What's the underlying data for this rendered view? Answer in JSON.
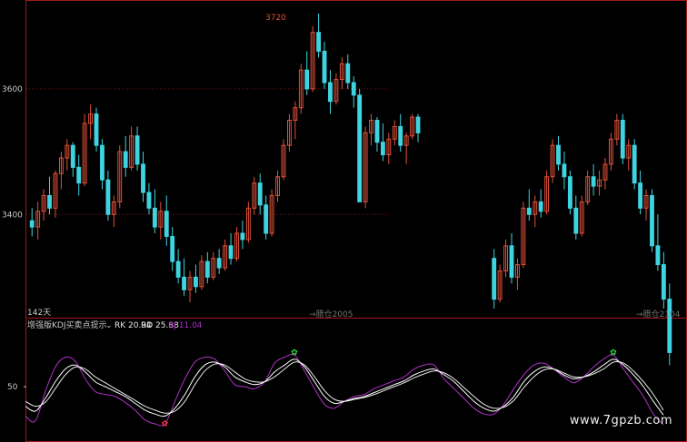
{
  "chart_data": [
    {
      "type": "candlestick",
      "ylim": [
        3250,
        3730
      ],
      "y_ticks": [
        3400,
        3600
      ],
      "annotations": {
        "peak_label": "3720",
        "bar_count": "142天",
        "date_mid": "→腊仓2005",
        "date_right": "→腊仓2104"
      },
      "colors": {
        "up": "#e0503a",
        "down": "#3fd3e0",
        "grid": "#7a1515",
        "frame": "#a01818",
        "text": "#c8c8c8"
      },
      "series": [
        {
          "name": "index",
          "ohlc": [
            [
              3390,
              3410,
              3365,
              3380
            ],
            [
              3380,
              3420,
              3360,
              3405
            ],
            [
              3405,
              3440,
              3390,
              3430
            ],
            [
              3430,
              3460,
              3400,
              3410
            ],
            [
              3410,
              3470,
              3395,
              3465
            ],
            [
              3465,
              3500,
              3440,
              3490
            ],
            [
              3490,
              3520,
              3470,
              3510
            ],
            [
              3510,
              3515,
              3460,
              3475
            ],
            [
              3475,
              3495,
              3430,
              3450
            ],
            [
              3450,
              3560,
              3445,
              3545
            ],
            [
              3545,
              3575,
              3520,
              3560
            ],
            [
              3560,
              3570,
              3500,
              3510
            ],
            [
              3510,
              3520,
              3440,
              3455
            ],
            [
              3455,
              3470,
              3390,
              3400
            ],
            [
              3400,
              3430,
              3380,
              3420
            ],
            [
              3420,
              3510,
              3410,
              3500
            ],
            [
              3500,
              3525,
              3460,
              3475
            ],
            [
              3475,
              3540,
              3470,
              3525
            ],
            [
              3525,
              3540,
              3470,
              3480
            ],
            [
              3480,
              3500,
              3420,
              3435
            ],
            [
              3435,
              3450,
              3400,
              3410
            ],
            [
              3410,
              3440,
              3370,
              3380
            ],
            [
              3380,
              3420,
              3360,
              3405
            ],
            [
              3405,
              3430,
              3350,
              3365
            ],
            [
              3365,
              3380,
              3310,
              3325
            ],
            [
              3325,
              3345,
              3290,
              3300
            ],
            [
              3300,
              3330,
              3270,
              3280
            ],
            [
              3280,
              3310,
              3260,
              3300
            ],
            [
              3300,
              3320,
              3275,
              3285
            ],
            [
              3285,
              3335,
              3280,
              3325
            ],
            [
              3325,
              3340,
              3290,
              3300
            ],
            [
              3300,
              3340,
              3295,
              3330
            ],
            [
              3330,
              3345,
              3305,
              3315
            ],
            [
              3315,
              3360,
              3310,
              3350
            ],
            [
              3350,
              3370,
              3320,
              3330
            ],
            [
              3330,
              3380,
              3325,
              3370
            ],
            [
              3370,
              3390,
              3345,
              3360
            ],
            [
              3360,
              3420,
              3355,
              3410
            ],
            [
              3410,
              3460,
              3400,
              3450
            ],
            [
              3450,
              3465,
              3400,
              3415
            ],
            [
              3415,
              3430,
              3360,
              3370
            ],
            [
              3370,
              3440,
              3365,
              3430
            ],
            [
              3430,
              3470,
              3420,
              3460
            ],
            [
              3460,
              3520,
              3455,
              3510
            ],
            [
              3510,
              3560,
              3500,
              3550
            ],
            [
              3550,
              3580,
              3520,
              3570
            ],
            [
              3570,
              3640,
              3560,
              3630
            ],
            [
              3630,
              3660,
              3590,
              3600
            ],
            [
              3600,
              3700,
              3595,
              3690
            ],
            [
              3690,
              3720,
              3650,
              3660
            ],
            [
              3660,
              3675,
              3600,
              3610
            ],
            [
              3610,
              3630,
              3560,
              3580
            ],
            [
              3580,
              3625,
              3575,
              3615
            ],
            [
              3615,
              3650,
              3600,
              3640
            ],
            [
              3640,
              3655,
              3600,
              3610
            ],
            [
              3610,
              3620,
              3570,
              3590
            ],
            [
              3590,
              3600,
              3520,
              3420
            ],
            [
              3420,
              3540,
              3410,
              3530
            ],
            [
              3530,
              3560,
              3510,
              3550
            ],
            [
              3550,
              3555,
              3500,
              3515
            ],
            [
              3515,
              3545,
              3485,
              3495
            ],
            [
              3495,
              3530,
              3480,
              3520
            ],
            [
              3520,
              3550,
              3510,
              3540
            ],
            [
              3540,
              3560,
              3500,
              3510
            ],
            [
              3510,
              3530,
              3480,
              3525
            ],
            [
              3525,
              3560,
              3520,
              3555
            ],
            [
              3555,
              3560,
              3515,
              3530
            ],
            null,
            null,
            null,
            null,
            null,
            null,
            null,
            null,
            null,
            null,
            null,
            null,
            [
              3330,
              3345,
              3250,
              3265
            ],
            [
              3265,
              3320,
              3260,
              3310
            ],
            [
              3310,
              3360,
              3300,
              3350
            ],
            [
              3350,
              3370,
              3290,
              3300
            ],
            [
              3300,
              3330,
              3280,
              3320
            ],
            [
              3320,
              3420,
              3315,
              3410
            ],
            [
              3410,
              3440,
              3390,
              3400
            ],
            [
              3400,
              3430,
              3380,
              3420
            ],
            [
              3420,
              3440,
              3395,
              3405
            ],
            [
              3405,
              3470,
              3400,
              3460
            ],
            [
              3460,
              3520,
              3450,
              3510
            ],
            [
              3510,
              3525,
              3470,
              3480
            ],
            [
              3480,
              3500,
              3440,
              3460
            ],
            [
              3460,
              3470,
              3400,
              3410
            ],
            [
              3410,
              3430,
              3360,
              3370
            ],
            [
              3370,
              3430,
              3365,
              3420
            ],
            [
              3420,
              3470,
              3415,
              3460
            ],
            [
              3460,
              3480,
              3430,
              3445
            ],
            [
              3445,
              3470,
              3430,
              3455
            ],
            [
              3455,
              3490,
              3440,
              3480
            ],
            [
              3480,
              3530,
              3470,
              3520
            ],
            [
              3520,
              3560,
              3510,
              3550
            ],
            [
              3550,
              3560,
              3480,
              3490
            ],
            [
              3490,
              3520,
              3470,
              3510
            ],
            [
              3510,
              3520,
              3440,
              3450
            ],
            [
              3450,
              3470,
              3400,
              3410
            ],
            [
              3410,
              3440,
              3390,
              3430
            ],
            [
              3430,
              3440,
              3340,
              3350
            ],
            [
              3350,
              3400,
              3310,
              3320
            ],
            [
              3320,
              3340,
              3250,
              3265
            ],
            [
              3265,
              3290,
              3160,
              3180
            ]
          ]
        }
      ]
    },
    {
      "type": "line",
      "title": "增强版KDJ买卖点提示",
      "ylim": [
        0,
        100
      ],
      "y_ticks": [
        50
      ],
      "series": [
        {
          "name": "RK",
          "label": "RK 20.94",
          "color": "#ffffff",
          "values": [
            30,
            25,
            38,
            55,
            68,
            72,
            65,
            55,
            50,
            45,
            40,
            33,
            26,
            22,
            20,
            28,
            42,
            60,
            72,
            75,
            70,
            60,
            55,
            52,
            55,
            65,
            72,
            78,
            70,
            55,
            40,
            33,
            35,
            38,
            40,
            44,
            48,
            52,
            56,
            62,
            66,
            68,
            62,
            55,
            45,
            35,
            28,
            25,
            30,
            40,
            55,
            65,
            70,
            68,
            62,
            58,
            60,
            65,
            72,
            78,
            72,
            62,
            50,
            35,
            21
          ]
        },
        {
          "name": "RD",
          "label": "RD 25.88",
          "color": "#e8e8e8",
          "values": [
            35,
            30,
            34,
            48,
            62,
            70,
            68,
            60,
            54,
            48,
            42,
            36,
            30,
            26,
            23,
            25,
            35,
            52,
            66,
            73,
            72,
            65,
            58,
            55,
            55,
            60,
            68,
            75,
            72,
            60,
            46,
            37,
            35,
            37,
            39,
            42,
            46,
            50,
            54,
            59,
            63,
            66,
            64,
            58,
            49,
            40,
            32,
            28,
            29,
            36,
            49,
            60,
            67,
            68,
            64,
            60,
            60,
            63,
            68,
            75,
            74,
            66,
            55,
            42,
            26
          ]
        },
        {
          "name": "RJ",
          "label": "RJ 11.04",
          "color": "#b030c8",
          "values": [
            20,
            15,
            45,
            70,
            80,
            76,
            58,
            45,
            42,
            40,
            34,
            26,
            16,
            12,
            12,
            35,
            58,
            75,
            80,
            78,
            66,
            52,
            50,
            48,
            55,
            74,
            80,
            82,
            66,
            48,
            32,
            28,
            35,
            40,
            42,
            48,
            52,
            56,
            60,
            68,
            72,
            72,
            58,
            48,
            38,
            28,
            22,
            22,
            32,
            48,
            62,
            72,
            74,
            68,
            60,
            54,
            60,
            70,
            78,
            82,
            68,
            54,
            40,
            22,
            11
          ]
        }
      ],
      "markers": [
        {
          "type": "sell",
          "color": "#30e040",
          "index": 27
        },
        {
          "type": "buy",
          "color": "#ff3030",
          "index": 14
        },
        {
          "type": "sell",
          "color": "#30e040",
          "index": 59
        }
      ]
    }
  ],
  "watermark": "www.7gpzb.com"
}
